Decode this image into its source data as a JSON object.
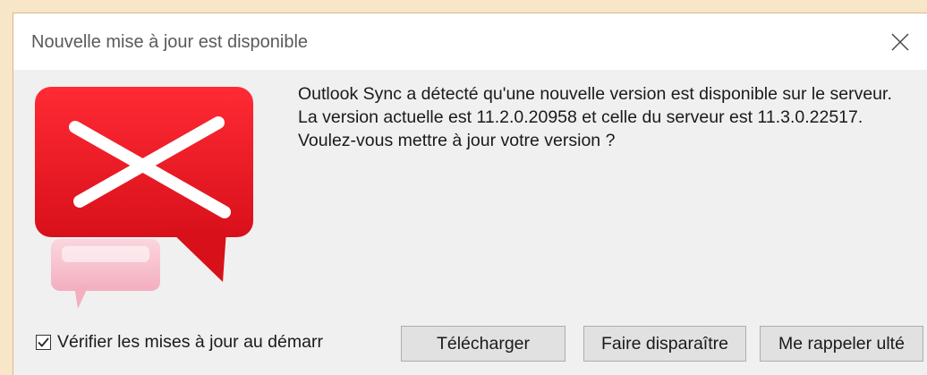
{
  "window": {
    "title": "Nouvelle mise à jour est disponible"
  },
  "message": {
    "text": "Outlook Sync a détecté qu'une nouvelle version est disponible sur le serveur. La version actuelle est 11.2.0.20958 et celle du serveur est 11.3.0.22517. Voulez-vous mettre à jour votre version ?"
  },
  "checkbox": {
    "label": "Vérifier les mises à jour au démarr",
    "checked": true
  },
  "buttons": {
    "download_label": "Télécharger",
    "dismiss_label": "Faire disparaître",
    "remind_label": "Me rappeler ulté"
  },
  "icons": {
    "close": "close-icon",
    "app": "envelope-chat-icon",
    "check": "checkmark-icon"
  },
  "colors": {
    "icon_red": "#e8141e",
    "icon_pink": "#f5b8c6",
    "titlebar": "#ffffff",
    "dialog_bg": "#f0f0f0"
  }
}
